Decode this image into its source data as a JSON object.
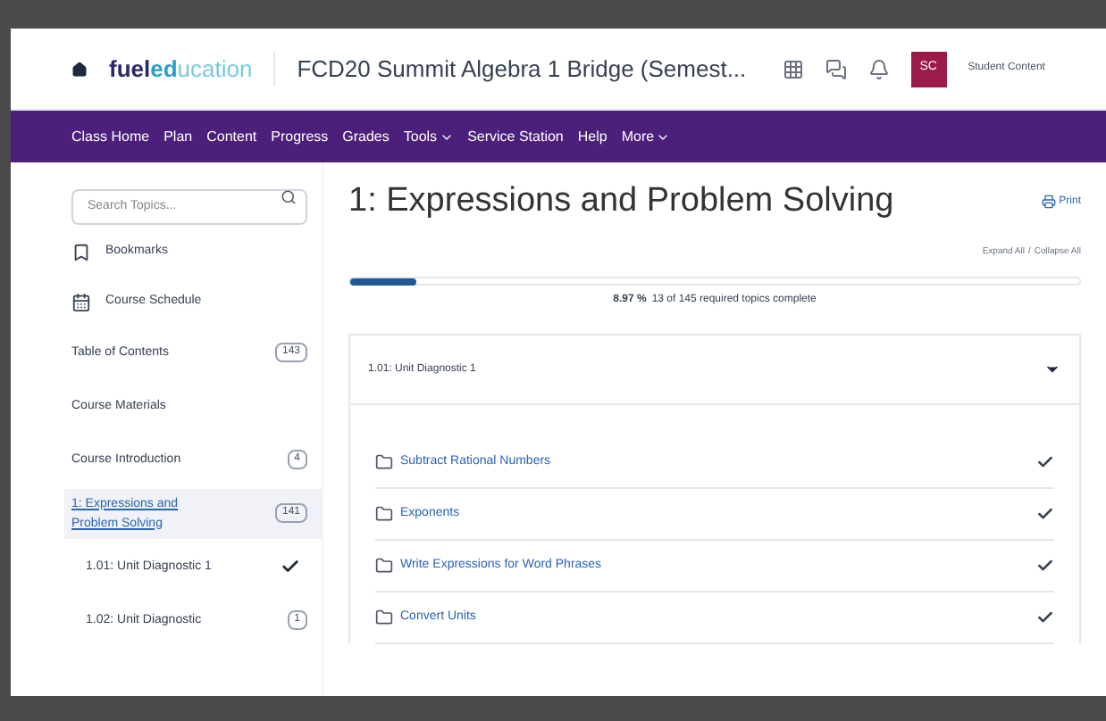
{
  "header": {
    "brand_dark": "fuel",
    "brand_accent": "ed",
    "brand_light": "ucation",
    "course_title": "FCD20 Summit Algebra 1 Bridge (Semest...",
    "avatar_initials": "SC",
    "user_name": "Student Content"
  },
  "nav": [
    {
      "label": "Class Home",
      "dropdown": false
    },
    {
      "label": "Plan",
      "dropdown": false
    },
    {
      "label": "Content",
      "dropdown": false
    },
    {
      "label": "Progress",
      "dropdown": false
    },
    {
      "label": "Grades",
      "dropdown": false
    },
    {
      "label": "Tools",
      "dropdown": true
    },
    {
      "label": "Service Station",
      "dropdown": false
    },
    {
      "label": "Help",
      "dropdown": false
    },
    {
      "label": "More",
      "dropdown": true
    }
  ],
  "sidebar": {
    "search": {
      "placeholder": "Search Topics..."
    },
    "links": [
      {
        "kind": "bookmark",
        "label": "Bookmarks"
      },
      {
        "kind": "calendar",
        "label": "Course Schedule"
      }
    ],
    "items": [
      {
        "label": "Table of Contents",
        "count": "143",
        "selected": false,
        "complete": false,
        "sub": false
      },
      {
        "label": "Course Materials",
        "selected": false,
        "complete": false,
        "sub": false
      },
      {
        "label": "Course Introduction",
        "count": "4",
        "selected": false,
        "complete": false,
        "sub": false
      },
      {
        "label": "1: Expressions and Problem Solving",
        "count": "141",
        "selected": true,
        "complete": false,
        "sub": false
      },
      {
        "label": "1.01: Unit Diagnostic 1",
        "selected": false,
        "complete": true,
        "sub": true
      },
      {
        "label": "1.02: Unit Diagnostic",
        "count": "1",
        "selected": false,
        "complete": false,
        "sub": true
      }
    ]
  },
  "main": {
    "title": "1: Expressions and Problem Solving",
    "print": "Print",
    "expand_all": "Expand All",
    "separator": "/",
    "collapse_all": "Collapse All",
    "progress": {
      "level": 0.09,
      "percent": "8.97 %",
      "summary": "13 of 145 required topics complete"
    },
    "section": {
      "title": "1.01: Unit Diagnostic 1",
      "expanded": true
    },
    "topics": [
      {
        "label": "Subtract Rational Numbers",
        "complete": true
      },
      {
        "label": "Exponents",
        "complete": true
      },
      {
        "label": "Write Expressions for Word Phrases",
        "complete": true
      },
      {
        "label": "Convert Units",
        "complete": true
      }
    ]
  }
}
